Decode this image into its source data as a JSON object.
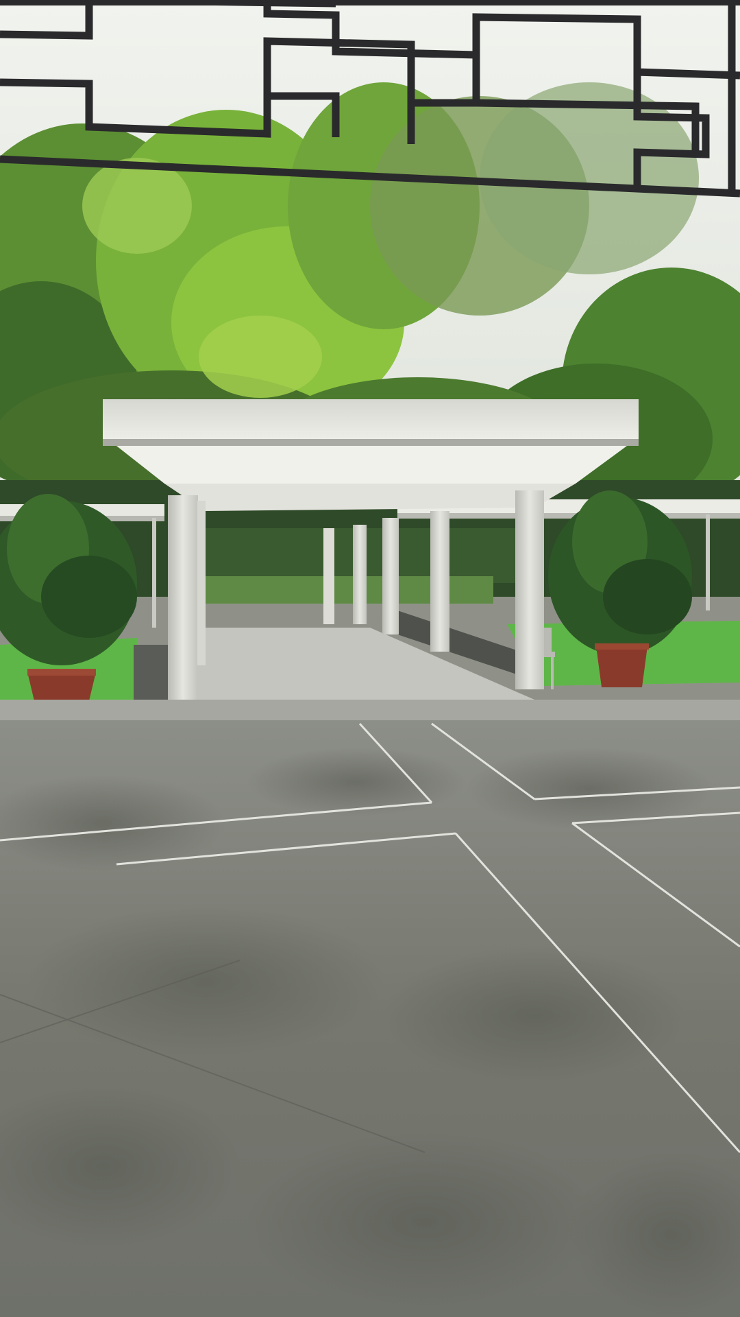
{
  "scene": {
    "kind": "photo",
    "subject": "covered-walkway-pavilion",
    "colors": {
      "sky": "#e8ece6",
      "foliage_light": "#7fb83a",
      "foliage_dark": "#3f6b2a",
      "lawn": "#5fb648",
      "canopy": "#e4e4de",
      "floor": "#7a7c76",
      "lattice": "#2a2a2c",
      "pot": "#8a3a2a"
    }
  }
}
